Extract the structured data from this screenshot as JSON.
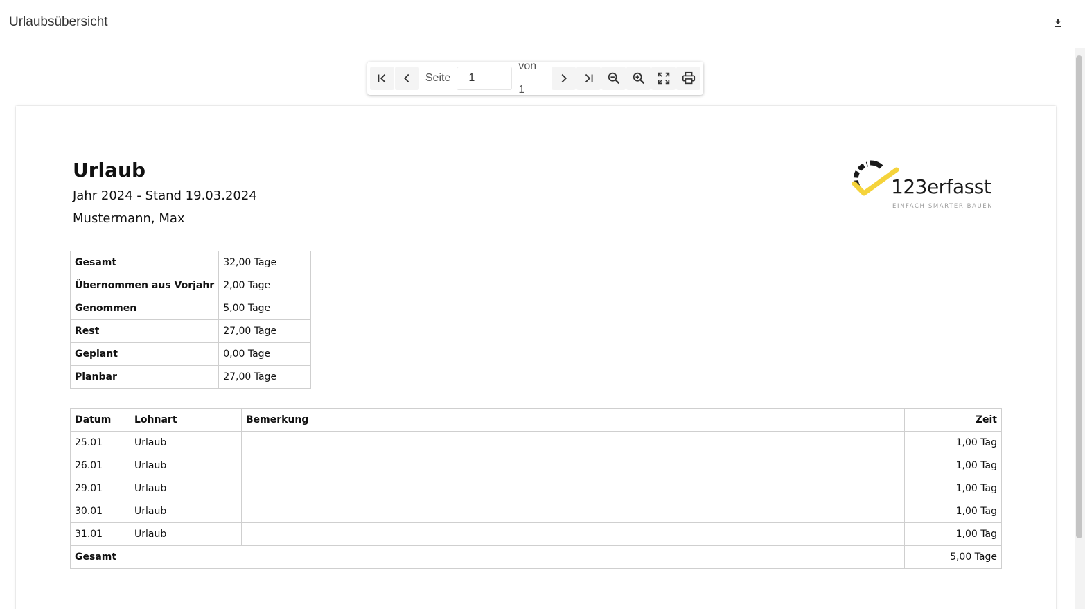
{
  "app": {
    "title": "Urlaubsübersicht",
    "download_icon": "download-icon"
  },
  "toolbar": {
    "page_label": "Seite",
    "page_value": "1",
    "of_label": "von 1",
    "icons": [
      "first-page-icon",
      "previous-page-icon",
      "next-page-icon",
      "last-page-icon",
      "zoom-out-icon",
      "zoom-in-icon",
      "fullscreen-icon",
      "print-icon"
    ]
  },
  "document": {
    "title": "Urlaub",
    "subtitle": "Jahr 2024 - Stand 19.03.2024",
    "employee": "Mustermann, Max",
    "logo": {
      "name": "123erfasst",
      "tagline": "EINFACH SMARTER BAUEN",
      "accent_color": "#f5d33b"
    },
    "summary": [
      {
        "label": "Gesamt",
        "value": "32,00 Tage"
      },
      {
        "label": "Übernommen aus Vorjahr",
        "value": "2,00 Tage"
      },
      {
        "label": "Genommen",
        "value": "5,00 Tage"
      },
      {
        "label": "Rest",
        "value": "27,00 Tage"
      },
      {
        "label": "Geplant",
        "value": "0,00 Tage"
      },
      {
        "label": "Planbar",
        "value": "27,00 Tage"
      }
    ],
    "entries": {
      "headers": [
        "Datum",
        "Lohnart",
        "Bemerkung",
        "Zeit"
      ],
      "rows": [
        {
          "date": "25.01",
          "type": "Urlaub",
          "note": "",
          "time": "1,00 Tag"
        },
        {
          "date": "26.01",
          "type": "Urlaub",
          "note": "",
          "time": "1,00 Tag"
        },
        {
          "date": "29.01",
          "type": "Urlaub",
          "note": "",
          "time": "1,00 Tag"
        },
        {
          "date": "30.01",
          "type": "Urlaub",
          "note": "",
          "time": "1,00 Tag"
        },
        {
          "date": "31.01",
          "type": "Urlaub",
          "note": "",
          "time": "1,00 Tag"
        }
      ],
      "total_label": "Gesamt",
      "total_value": "5,00 Tage"
    }
  }
}
